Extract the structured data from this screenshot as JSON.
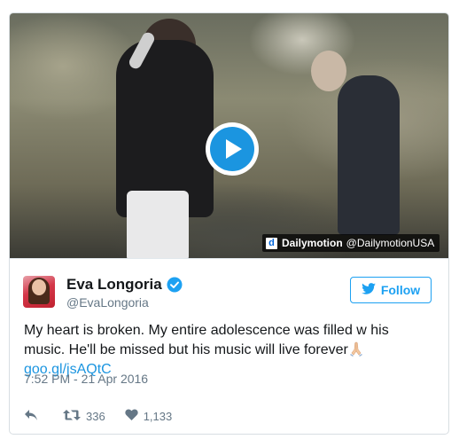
{
  "video": {
    "provider_badge": "d",
    "provider_name": "Dailymotion",
    "provider_handle": "@DailymotionUSA"
  },
  "author": {
    "name": "Eva Longoria",
    "handle": "@EvaLongoria",
    "verified": true
  },
  "follow_button": {
    "label": "Follow"
  },
  "tweet": {
    "text": "My heart is broken. My entire adolescence was filled w his music. He'll be missed but his music will live forever",
    "link": "goo.gl/jsAQtC",
    "timestamp": "7:52 PM - 21 Apr 2016"
  },
  "actions": {
    "retweet_count": "336",
    "like_count": "1,133"
  },
  "icons": [
    "play-icon",
    "dailymotion-icon",
    "verified-icon",
    "twitter-bird-icon",
    "reply-icon",
    "retweet-icon",
    "heart-icon",
    "praying-hands-emoji"
  ],
  "colors": {
    "accent": "#1da1f2",
    "play": "#1b95e0",
    "text": "#14171a",
    "muted": "#657786"
  }
}
